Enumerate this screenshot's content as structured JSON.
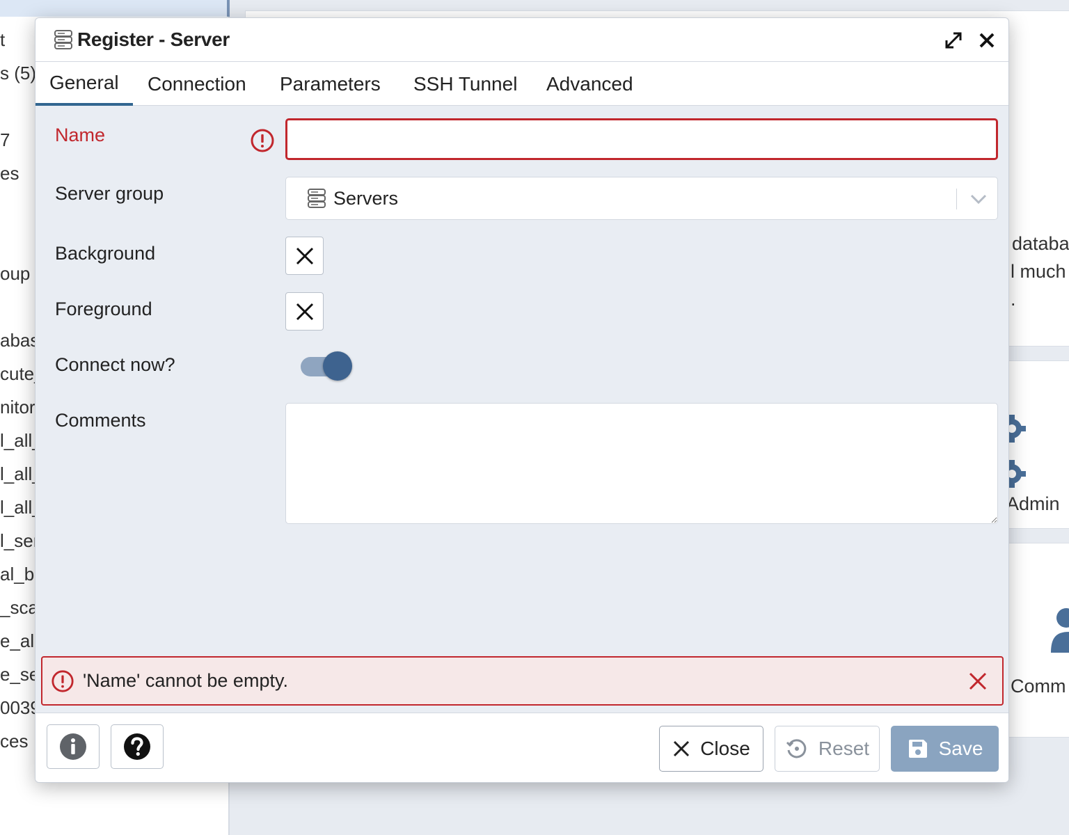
{
  "background": {
    "tree_items": [
      "t",
      "s (5)",
      "7",
      "es",
      "oup F",
      "abas",
      "cute_",
      "nitor",
      "l_all_",
      "l_all_",
      "l_all_",
      "l_ser",
      "al_b",
      "_sca",
      "e_all",
      "e_se",
      "0039",
      "ces"
    ],
    "main_texts": [
      "databa",
      "l much",
      ".",
      "Admin",
      "Comm"
    ]
  },
  "dialog": {
    "title": "Register - Server",
    "title_icon": "server-group-icon",
    "tabs": [
      {
        "label": "General",
        "active": true
      },
      {
        "label": "Connection",
        "active": false
      },
      {
        "label": "Parameters",
        "active": false
      },
      {
        "label": "SSH Tunnel",
        "active": false
      },
      {
        "label": "Advanced",
        "active": false
      }
    ],
    "form": {
      "name_label": "Name",
      "name_value": "",
      "server_group_label": "Server group",
      "server_group_value": "Servers",
      "background_label": "Background",
      "foreground_label": "Foreground",
      "connect_now_label": "Connect now?",
      "connect_now_value": true,
      "comments_label": "Comments",
      "comments_value": ""
    },
    "error_message": "'Name' cannot be empty.",
    "footer": {
      "info_icon": "info-icon",
      "help_icon": "help-icon",
      "close_label": "Close",
      "reset_label": "Reset",
      "save_label": "Save"
    }
  },
  "colors": {
    "accent": "#326690",
    "error": "#c1272d",
    "error_bg": "#f6e8e8",
    "save_disabled": "#8aa4c0",
    "toggle_knob": "#3e638f"
  }
}
